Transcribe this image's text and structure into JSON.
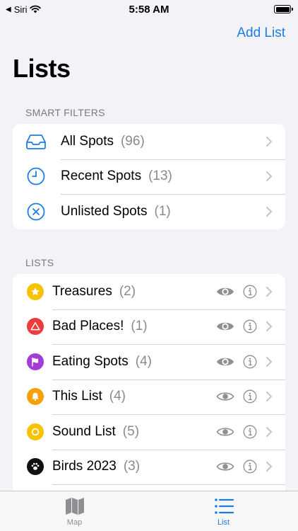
{
  "status_bar": {
    "carrier": "Siri",
    "time": "5:58 AM"
  },
  "nav": {
    "action_label": "Add List",
    "title": "Lists"
  },
  "smart_filters": {
    "header": "SMART FILTERS",
    "items": [
      {
        "label": "All Spots",
        "count": "(96)",
        "icon": "tray-icon"
      },
      {
        "label": "Recent Spots",
        "count": "(13)",
        "icon": "clock-icon"
      },
      {
        "label": "Unlisted Spots",
        "count": "(1)",
        "icon": "x-circle-icon"
      }
    ]
  },
  "lists": {
    "header": "LISTS",
    "items": [
      {
        "label": "Treasures",
        "count": "(2)",
        "icon": "star-icon",
        "color": "#f7c300",
        "visible": true
      },
      {
        "label": "Bad Places!",
        "count": "(1)",
        "icon": "warning-triangle-icon",
        "color": "#ee3b3b",
        "visible": true
      },
      {
        "label": "Eating Spots",
        "count": "(4)",
        "icon": "flag-icon",
        "color": "#a43cd6",
        "visible": true
      },
      {
        "label": "This List",
        "count": "(4)",
        "icon": "bell-icon",
        "color": "#f7a10a",
        "visible": false
      },
      {
        "label": "Sound List",
        "count": "(5)",
        "icon": "circle-icon",
        "color": "#f7c300",
        "visible": false
      },
      {
        "label": "Birds 2023",
        "count": "(3)",
        "icon": "paw-icon",
        "color": "#111111",
        "visible": false
      }
    ]
  },
  "tab_bar": {
    "tabs": [
      {
        "label": "Map",
        "icon": "map-icon",
        "active": false
      },
      {
        "label": "List",
        "icon": "list-icon",
        "active": true
      }
    ]
  },
  "colors": {
    "accent": "#1a7ee6",
    "background": "#f2f2f7"
  }
}
